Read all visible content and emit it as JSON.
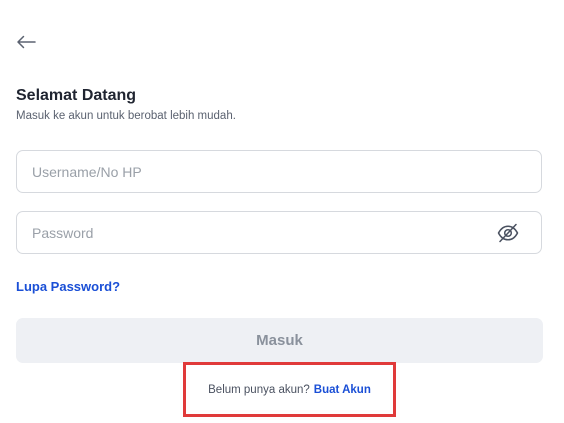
{
  "header": {
    "back_icon": "arrow-left-icon"
  },
  "welcome": {
    "title": "Selamat Datang",
    "subtitle": "Masuk ke akun untuk berobat lebih mudah."
  },
  "form": {
    "username": {
      "placeholder": "Username/No HP",
      "value": ""
    },
    "password": {
      "placeholder": "Password",
      "value": "",
      "toggle_icon": "eye-off-icon"
    },
    "forgot_password_label": "Lupa Password?",
    "submit_label": "Masuk"
  },
  "signup": {
    "prompt": "Belum punya akun?",
    "link_label": "Buat Akun"
  },
  "colors": {
    "link": "#1a4fd6",
    "button_bg": "#eef0f4",
    "button_text": "#8a919c",
    "highlight_border": "#e03a3a"
  }
}
